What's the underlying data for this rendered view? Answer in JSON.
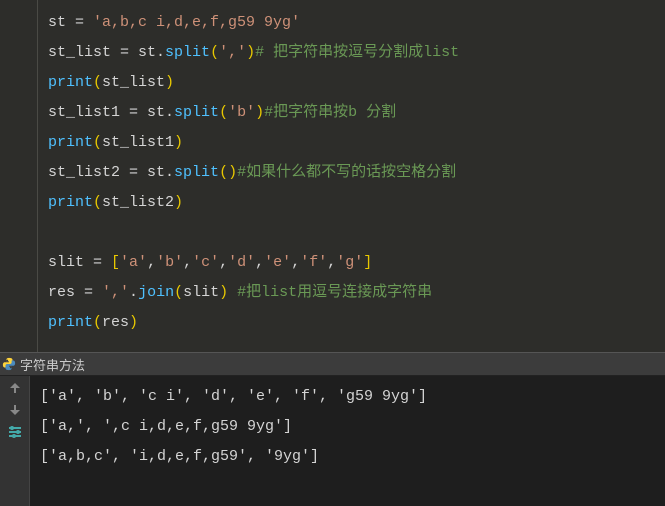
{
  "editor": {
    "lines": [
      {
        "tokens": [
          {
            "t": "op",
            "v": "st "
          },
          {
            "t": "op",
            "v": "= "
          },
          {
            "t": "str",
            "v": "'a,b,c i,d,e,f,g59 9yg'"
          }
        ]
      },
      {
        "tokens": [
          {
            "t": "op",
            "v": "st_list "
          },
          {
            "t": "op",
            "v": "= "
          },
          {
            "t": "op",
            "v": "st."
          },
          {
            "t": "func",
            "v": "split"
          },
          {
            "t": "paren",
            "v": "("
          },
          {
            "t": "str",
            "v": "','"
          },
          {
            "t": "paren",
            "v": ")"
          },
          {
            "t": "comment",
            "v": "# 把字符串按逗号分割成list"
          }
        ]
      },
      {
        "tokens": [
          {
            "t": "func",
            "v": "print"
          },
          {
            "t": "paren",
            "v": "("
          },
          {
            "t": "op",
            "v": "st_list"
          },
          {
            "t": "paren",
            "v": ")"
          }
        ]
      },
      {
        "tokens": [
          {
            "t": "op",
            "v": "st_list1 "
          },
          {
            "t": "op",
            "v": "= "
          },
          {
            "t": "op",
            "v": "st."
          },
          {
            "t": "func",
            "v": "split"
          },
          {
            "t": "paren",
            "v": "("
          },
          {
            "t": "str",
            "v": "'b'"
          },
          {
            "t": "paren",
            "v": ")"
          },
          {
            "t": "comment",
            "v": "#把字符串按b 分割"
          }
        ]
      },
      {
        "tokens": [
          {
            "t": "func",
            "v": "print"
          },
          {
            "t": "paren",
            "v": "("
          },
          {
            "t": "op",
            "v": "st_list1"
          },
          {
            "t": "paren",
            "v": ")"
          }
        ]
      },
      {
        "tokens": [
          {
            "t": "op",
            "v": "st_list2 "
          },
          {
            "t": "op",
            "v": "= "
          },
          {
            "t": "op",
            "v": "st."
          },
          {
            "t": "func",
            "v": "split"
          },
          {
            "t": "paren",
            "v": "()"
          },
          {
            "t": "comment",
            "v": "#如果什么都不写的话按空格分割"
          }
        ]
      },
      {
        "tokens": [
          {
            "t": "func",
            "v": "print"
          },
          {
            "t": "paren",
            "v": "("
          },
          {
            "t": "op",
            "v": "st_list2"
          },
          {
            "t": "paren",
            "v": ")"
          }
        ]
      },
      {
        "tokens": [
          {
            "t": "op",
            "v": " "
          }
        ]
      },
      {
        "tokens": [
          {
            "t": "op",
            "v": "slit "
          },
          {
            "t": "op",
            "v": "= "
          },
          {
            "t": "paren",
            "v": "["
          },
          {
            "t": "str",
            "v": "'a'"
          },
          {
            "t": "op",
            "v": ","
          },
          {
            "t": "str",
            "v": "'b'"
          },
          {
            "t": "op",
            "v": ","
          },
          {
            "t": "str",
            "v": "'c'"
          },
          {
            "t": "op",
            "v": ","
          },
          {
            "t": "str",
            "v": "'d'"
          },
          {
            "t": "op",
            "v": ","
          },
          {
            "t": "str",
            "v": "'e'"
          },
          {
            "t": "op",
            "v": ","
          },
          {
            "t": "str",
            "v": "'f'"
          },
          {
            "t": "op",
            "v": ","
          },
          {
            "t": "str",
            "v": "'g'"
          },
          {
            "t": "paren",
            "v": "]"
          }
        ]
      },
      {
        "tokens": [
          {
            "t": "op",
            "v": "res "
          },
          {
            "t": "op",
            "v": "= "
          },
          {
            "t": "str",
            "v": "','"
          },
          {
            "t": "op",
            "v": "."
          },
          {
            "t": "func",
            "v": "join"
          },
          {
            "t": "paren",
            "v": "("
          },
          {
            "t": "op",
            "v": "slit"
          },
          {
            "t": "paren",
            "v": ")"
          },
          {
            "t": "op",
            "v": " "
          },
          {
            "t": "comment",
            "v": "#把list用逗号连接成字符串"
          }
        ]
      },
      {
        "tokens": [
          {
            "t": "func",
            "v": "print"
          },
          {
            "t": "paren",
            "v": "("
          },
          {
            "t": "op",
            "v": "res"
          },
          {
            "t": "paren",
            "v": ")"
          }
        ]
      }
    ]
  },
  "separator": {
    "label": "字符串方法"
  },
  "output": {
    "lines": [
      "['a', 'b', 'c i', 'd', 'e', 'f', 'g59 9yg']",
      "['a,', ',c i,d,e,f,g59 9yg']",
      "['a,b,c', 'i,d,e,f,g59', '9yg']"
    ]
  }
}
